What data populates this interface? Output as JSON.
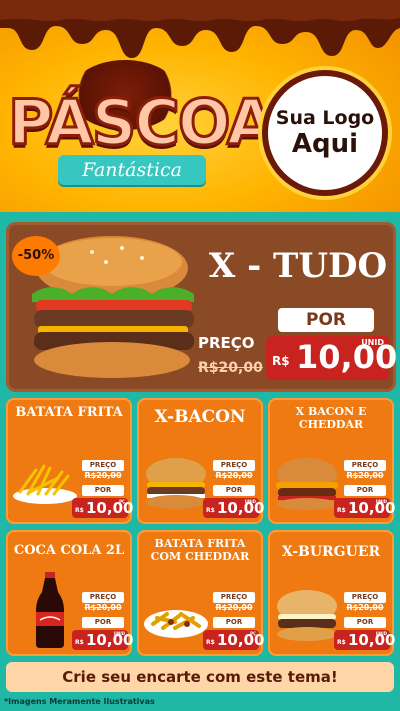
{
  "header": {
    "title": "PÁSCOA",
    "subtitle": "Fantástica",
    "logo_line1": "Sua Logo",
    "logo_line2": "Aqui"
  },
  "featured": {
    "discount": "-50%",
    "name": "X - TUDO",
    "preco_label": "PREÇO",
    "old_price": "R$20,00",
    "por_label": "POR",
    "currency": "R$",
    "price": "10,00",
    "unit": "UNID"
  },
  "items": [
    {
      "name": "BATATA FRITA",
      "preco_label": "PREÇO",
      "old_price": "R$20,00",
      "por_label": "POR",
      "currency": "R$",
      "price": "10,00",
      "unit": "PÇ"
    },
    {
      "name": "X-BACON",
      "preco_label": "PREÇO",
      "old_price": "R$20,00",
      "por_label": "POR",
      "currency": "R$",
      "price": "10,00",
      "unit": "UNID"
    },
    {
      "name": "X BACON E CHEDDAR",
      "preco_label": "PREÇO",
      "old_price": "R$20,00",
      "por_label": "POR",
      "currency": "R$",
      "price": "10,00",
      "unit": "UNID"
    },
    {
      "name": "COCA COLA 2L",
      "preco_label": "PREÇO",
      "old_price": "R$20,00",
      "por_label": "POR",
      "currency": "R$",
      "price": "10,00",
      "unit": "UNID"
    },
    {
      "name": "BATATA FRITA COM CHEDDAR",
      "preco_label": "PREÇO",
      "old_price": "R$20,00",
      "por_label": "POR",
      "currency": "R$",
      "price": "10,00",
      "unit": "PÇ"
    },
    {
      "name": "X-BURGUER",
      "preco_label": "PREÇO",
      "old_price": "R$20,00",
      "por_label": "POR",
      "currency": "R$",
      "price": "10,00",
      "unit": "UNID"
    }
  ],
  "cta": "Crie seu encarte com este tema!",
  "disclaimer": "*Imagens Meramente Ilustrativas",
  "colors": {
    "teal": "#1fb7a6",
    "orange": "#f07a12",
    "brown": "#8a4a26",
    "red": "#c8231e",
    "yellow": "#ffb400"
  }
}
